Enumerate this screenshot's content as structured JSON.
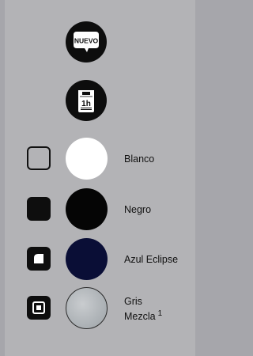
{
  "badges": {
    "nuevo": {
      "text": "NUEVO",
      "icon": "nuevo-badge-icon"
    },
    "one_hour": {
      "text": "1h",
      "icon": "one-hour-tag-icon"
    }
  },
  "colors": [
    {
      "name": "Blanco",
      "hex": "#ffffff",
      "checkbox_style": "empty"
    },
    {
      "name": "Negro",
      "hex": "#050505",
      "checkbox_style": "filled"
    },
    {
      "name": "Azul Eclipse",
      "hex": "#0a0e36",
      "checkbox_style": "filled-corner"
    },
    {
      "name_line1": "Gris",
      "name_line2": "Mezcla",
      "footnote": "1",
      "hex": "#b0b4b8",
      "checkbox_style": "filled-square"
    }
  ]
}
